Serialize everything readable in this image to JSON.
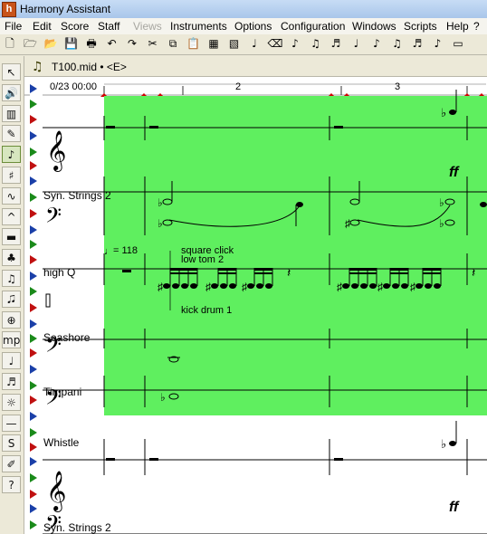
{
  "window": {
    "title": "Harmony Assistant",
    "app_icon": "h"
  },
  "menu": [
    {
      "label": "File",
      "disabled": false
    },
    {
      "label": "Edit",
      "disabled": false
    },
    {
      "label": "Score",
      "disabled": false
    },
    {
      "label": "Staff",
      "disabled": false
    },
    {
      "label": "Views",
      "disabled": true
    },
    {
      "label": "Instruments",
      "disabled": false
    },
    {
      "label": "Options",
      "disabled": false
    },
    {
      "label": "Configuration",
      "disabled": false
    },
    {
      "label": "Windows",
      "disabled": false
    },
    {
      "label": "Scripts",
      "disabled": false
    },
    {
      "label": "Help",
      "disabled": false
    },
    {
      "label": "?",
      "disabled": false
    }
  ],
  "toolbar": [
    "new-icon",
    "open-icon",
    "folder-icon",
    "save-icon",
    "print-icon",
    "undo-icon",
    "redo-icon",
    "cut-icon",
    "copy-icon",
    "paste-icon",
    "select-all-icon",
    "select-staff-icon",
    "note-icon",
    "eraser-icon",
    "note-icon-2",
    "note-icon-3",
    "note-icon-4",
    "note-icon-5",
    "note-icon-6",
    "note-icon-7",
    "note-icon-8",
    "note-icon-9",
    "piano-icon"
  ],
  "palette": [
    "arrow-tool-icon",
    "speaker-tool-icon",
    "keyboard-tool-icon",
    "pencil-tool-icon",
    "note-tool-icon",
    "sharp-tool-icon",
    "trill-tool-icon",
    "accent-tool-icon",
    "rest-tool-icon",
    "chord-tool-icon",
    "grace-tool-icon",
    "lyrics-tool-icon",
    "target-tool-icon",
    "dynamics-tool-icon",
    "guitar-tool-icon",
    "drum-tool-icon",
    "sun-tool-icon",
    "line-tool-icon",
    "s-tool-icon",
    "pen-tool-icon",
    "help-tool-icon"
  ],
  "palette_glyphs": [
    "↖",
    "🔊",
    "▥",
    "✎",
    "♪",
    "♯",
    "∿",
    "^",
    "▬",
    "♣",
    "♫",
    "🎜",
    "⊕",
    "mp",
    "♩",
    "♬",
    "☼",
    "—",
    "S",
    "✐",
    "?"
  ],
  "document": {
    "title": "T100.mid • <E>"
  },
  "ruler": {
    "time": "0/23 00:00",
    "measures": [
      "2",
      "3"
    ]
  },
  "staves": [
    {
      "name": "Syn. Strings 2"
    },
    {
      "name": "high Q"
    },
    {
      "name": "Seashore"
    },
    {
      "name": "Timpani"
    },
    {
      "name": "Whistle"
    },
    {
      "name": "Syn. Strings 2"
    }
  ],
  "annotations": {
    "tempo": "= 118",
    "square_click": "square click",
    "low_tom": "low tom 2",
    "kick_drum": "kick drum 1",
    "dynamic_1": "ff",
    "dynamic_2": "ff"
  },
  "colors": {
    "selection": "#5fef5f",
    "menu_bg": "#f5f4ee",
    "chrome": "#ece9d8"
  }
}
